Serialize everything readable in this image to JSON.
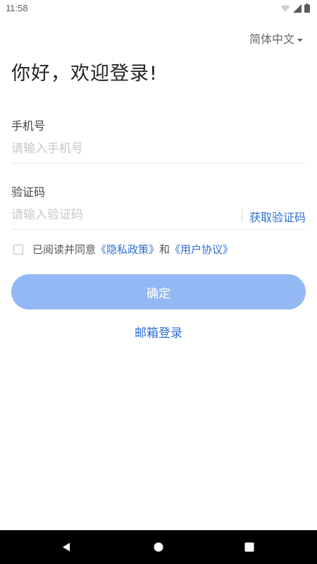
{
  "status_bar": {
    "time": "11:58",
    "icons": [
      "wifi-icon",
      "signal-icon",
      "battery-icon"
    ]
  },
  "header": {
    "language": "简体中文"
  },
  "main": {
    "title": "你好，欢迎登录!",
    "phone": {
      "label": "手机号",
      "placeholder": "请输入手机号",
      "value": ""
    },
    "code": {
      "label": "验证码",
      "placeholder": "请输入验证码",
      "value": "",
      "get_code_label": "获取验证码"
    },
    "agreement": {
      "checked": false,
      "prefix": "已阅读并同意",
      "privacy_link": "《隐私政策》",
      "joiner": "和",
      "terms_link": "《用户协议》"
    },
    "confirm_label": "确定",
    "email_login_label": "邮箱登录"
  },
  "nav_bar": {
    "icons": [
      "back-icon",
      "home-icon",
      "recents-icon"
    ]
  },
  "colors": {
    "accent": "#2f6fd6",
    "button_disabled": "#94b8f3",
    "nav_bar": "#000000"
  }
}
